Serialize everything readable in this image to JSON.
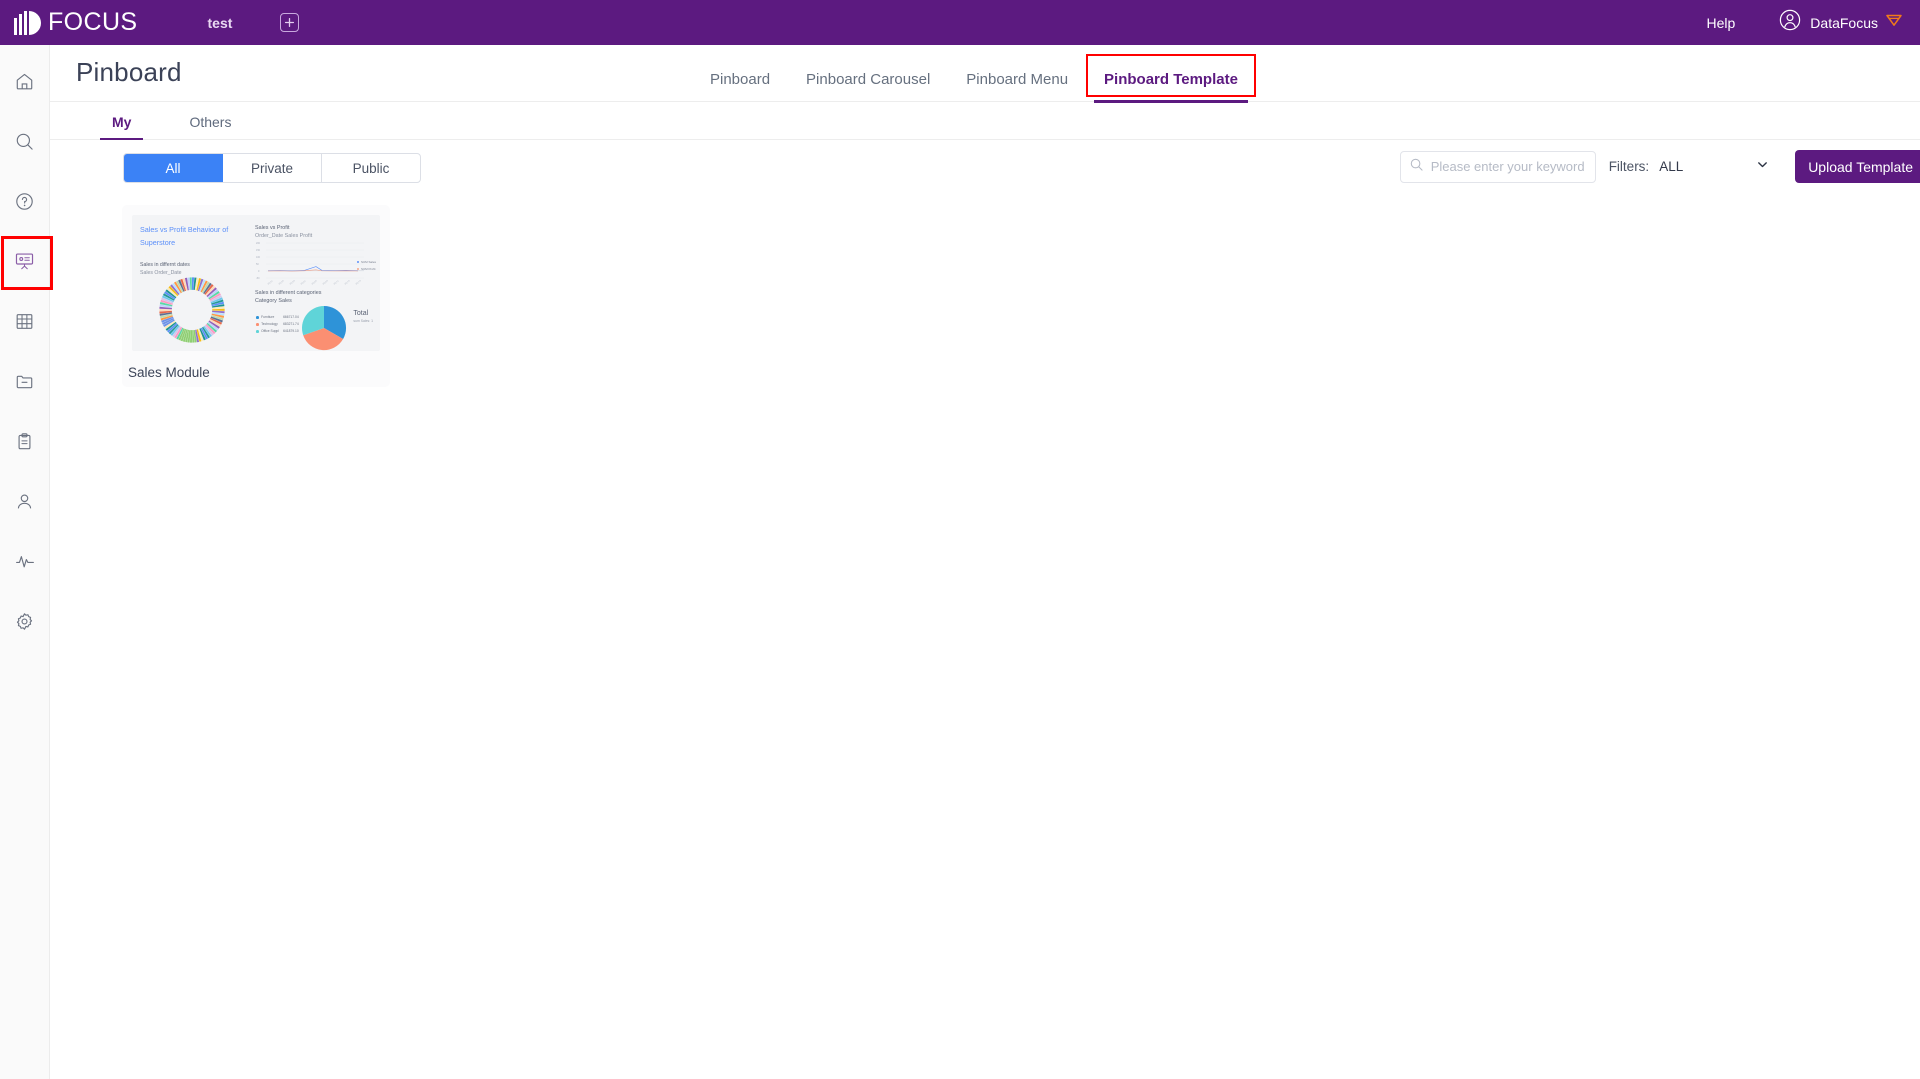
{
  "topbar": {
    "brand": "FOCUS",
    "workbook_tab": "test",
    "add_tab_icon": "plus-square-icon",
    "help": "Help",
    "user_name": "DataFocus",
    "user_avatar_icon": "user-circle-icon",
    "crown_icon": "crown-icon"
  },
  "sidebar": {
    "items": [
      {
        "name": "home",
        "icon": "home-icon",
        "active": false
      },
      {
        "name": "search",
        "icon": "search-icon",
        "active": false
      },
      {
        "name": "help",
        "icon": "question-circle-icon",
        "active": false
      },
      {
        "name": "pinboard",
        "icon": "presentation-board-icon",
        "active": true
      },
      {
        "name": "table",
        "icon": "grid-table-icon",
        "active": false
      },
      {
        "name": "folder",
        "icon": "folder-minus-icon",
        "active": false
      },
      {
        "name": "clipboard",
        "icon": "clipboard-icon",
        "active": false
      },
      {
        "name": "user",
        "icon": "user-icon",
        "active": false
      },
      {
        "name": "monitor",
        "icon": "activity-pulse-icon",
        "active": false
      },
      {
        "name": "settings",
        "icon": "gear-icon",
        "active": false
      }
    ]
  },
  "page": {
    "title": "Pinboard",
    "tabs": [
      {
        "label": "Pinboard",
        "current": false
      },
      {
        "label": "Pinboard Carousel",
        "current": false
      },
      {
        "label": "Pinboard Menu",
        "current": false
      },
      {
        "label": "Pinboard Template",
        "current": true,
        "highlighted": true
      }
    ],
    "subtabs": [
      {
        "label": "My",
        "current": true
      },
      {
        "label": "Others",
        "current": false
      }
    ]
  },
  "toolbar": {
    "segments": [
      {
        "label": "All",
        "selected": true
      },
      {
        "label": "Private",
        "selected": false
      },
      {
        "label": "Public",
        "selected": false
      }
    ],
    "search": {
      "value": "",
      "placeholder": "Please enter your keywords",
      "icon": "search-icon"
    },
    "filters_label": "Filters:",
    "filter_value": "ALL",
    "filter_options": [
      "ALL"
    ],
    "filter_caret_icon": "chevron-down-icon",
    "upload_label": "Upload Template"
  },
  "cards": [
    {
      "name": "Sales Module",
      "thumbnail": {
        "title": "Sales vs Profit Behaviour of Superstore",
        "left_chart": {
          "heading": "Sales in differnt dates",
          "subheading": "Sales Order_Date",
          "type": "donut"
        },
        "top_right_chart": {
          "heading": "Sales vs Profit",
          "subheading": "Order_Date Sales Profit",
          "type": "line",
          "legend": [
            "SUM Sales",
            "SUM Profit"
          ]
        },
        "bottom_right_chart": {
          "heading": "Sales in different categories",
          "subheading": "Category Sales",
          "type": "pie",
          "total_label": "Total",
          "total_sub": "sum Sales: 1",
          "legend": [
            {
              "name": "Furniture",
              "value": "666717.04"
            },
            {
              "name": "Technology",
              "value": "683271.74"
            },
            {
              "name": "Office Suppl",
              "value": "641879.10"
            }
          ]
        }
      }
    }
  ],
  "colors": {
    "brand_purple": "#5C1A80",
    "accent_blue": "#3b82f6",
    "highlight_red": "#ff0000",
    "pie_blue": "#2e93d8",
    "pie_salmon": "#fb8f72",
    "pie_cyan": "#5fd4d8"
  }
}
